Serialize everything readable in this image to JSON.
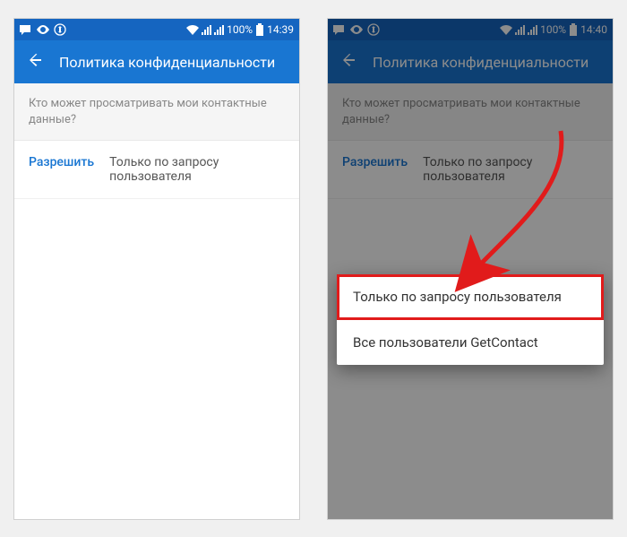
{
  "left": {
    "status": {
      "battery": "100%",
      "time": "14:39"
    },
    "appbar": {
      "title": "Политика конфиденциальности"
    },
    "section_header": "Кто может просматривать мои контактные данные?",
    "setting": {
      "label": "Разрешить",
      "value": "Только по запросу пользователя"
    }
  },
  "right": {
    "status": {
      "battery": "100%",
      "time": "14:40"
    },
    "appbar": {
      "title": "Политика конфиденциальности"
    },
    "section_header": "Кто может просматривать мои контактные данные?",
    "setting": {
      "label": "Разрешить",
      "value": "Только по запросу пользователя"
    },
    "dialog": {
      "option1": "Только по запросу пользователя",
      "option2": "Все пользователи GetContact"
    }
  }
}
